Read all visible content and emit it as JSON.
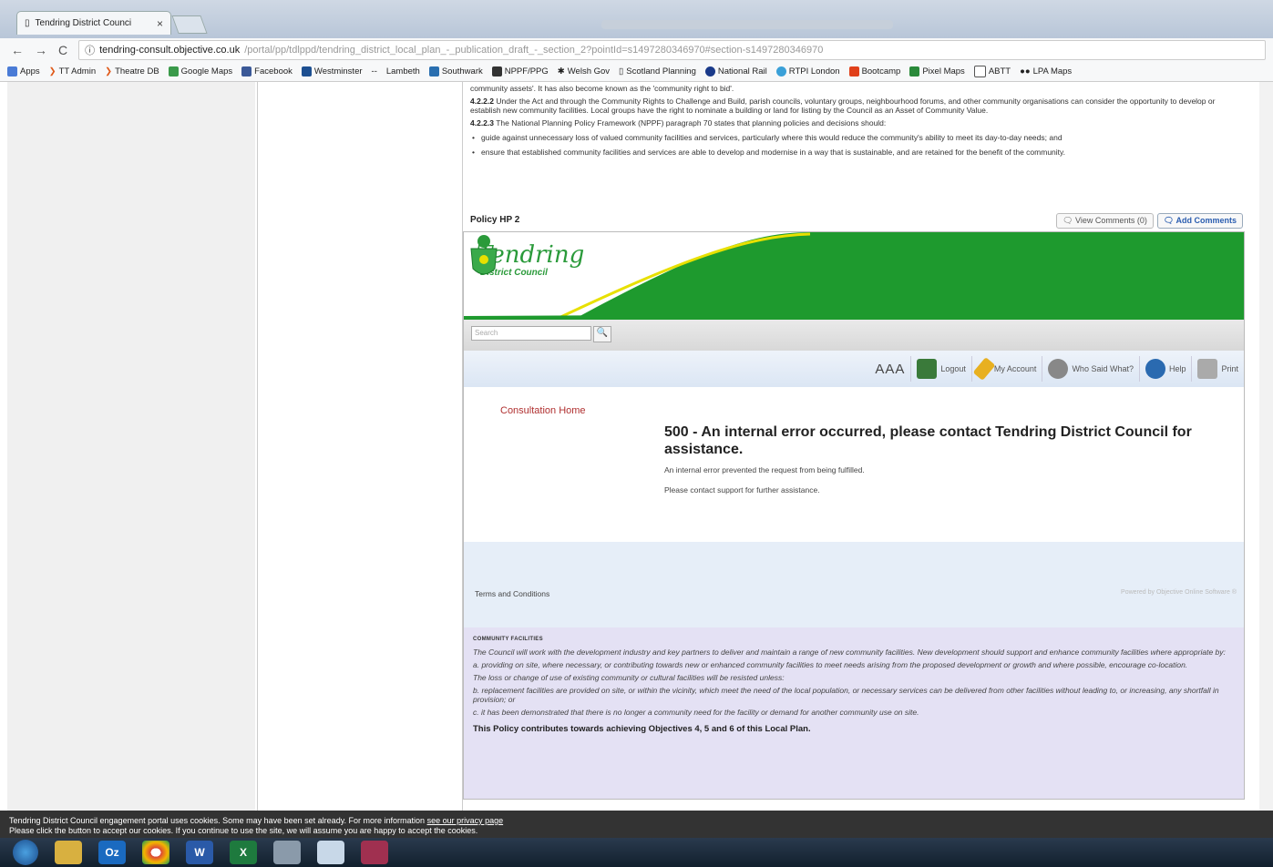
{
  "browser": {
    "tab_title": "Tendring District Counci",
    "tab_close": "×",
    "url_host": "tendring-consult.objective.co.uk",
    "url_path": "/portal/pp/tdlppd/tendring_district_local_plan_-_publication_draft_-_section_2?pointId=s1497280346970#section-s1497280346970",
    "bookmarks": [
      "Apps",
      "TT Admin",
      "Theatre DB",
      "Google Maps",
      "Facebook",
      "Westminster",
      "Lambeth",
      "Southwark",
      "NPPF/PPG",
      "Welsh Gov",
      "Scotland Planning",
      "National Rail",
      "RTPI London",
      "Bootcamp",
      "Pixel Maps",
      "ABTT",
      "LPA Maps"
    ],
    "bookmark_sep": "--"
  },
  "doc": {
    "line0": "community assets'. It has also become known as the 'community right to bid'.",
    "p1_num": "4.2.2.2",
    "p1": " Under the Act and through the Community Rights to Challenge and Build, parish councils, voluntary groups, neighbourhood forums, and other community organisations can consider the opportunity to develop or establish new community facilities. Local groups have the right to nominate a building or land for listing by the Council as an Asset of Community Value.",
    "p2_num": "4.2.2.3",
    "p2": " The National Planning Policy Framework (NPPF) paragraph 70 states that planning policies and decisions should:",
    "bullet1": "guide against unnecessary loss of valued community facilities and services, particularly where this would reduce the community's ability to meet its day-to-day needs; and",
    "bullet2": "ensure that established community facilities and services are able to develop and modernise in a way that is sustainable, and are retained for the benefit of the community.",
    "policy_heading": "Policy HP 2",
    "view_comments": "View Comments (0)",
    "add_comments": "Add Comments"
  },
  "frame": {
    "logo_title": "Tendring",
    "logo_sub": "District Council",
    "search_placeholder": "Search",
    "search_btn": "🔍",
    "aaa": "AAA",
    "tools": [
      "Logout",
      "My Account",
      "Who Said What?",
      "Help",
      "Print"
    ],
    "consultation_home": "Consultation Home",
    "error_title": "500 - An internal error occurred, please contact Tendring District Council for assistance.",
    "error_msg": "An internal error prevented the request from being fulfilled.",
    "error_msg2": "Please contact support for further assistance.",
    "terms": "Terms and Conditions",
    "powered": "Powered by Objective Online Software ®"
  },
  "policy": {
    "heading": "COMMUNITY FACILITIES",
    "l1": "The Council will work with the development industry and key partners to deliver and maintain a range of new community facilities. New development should support and enhance community facilities where appropriate by:",
    "l2": "a. providing on site, where necessary, or contributing towards new or enhanced community facilities to meet needs arising from the proposed development or growth and where possible, encourage co-location.",
    "l3": "The loss or change of use of existing community or cultural facilities will be resisted unless:",
    "l4": "b. replacement facilities are provided on site, or within the vicinity, which meet the need of the local population, or necessary services can be delivered from other facilities without leading to, or increasing, any shortfall in provision; or",
    "l5": "c. it has been demonstrated that there is no longer a community need for the facility or demand for another community use on site.",
    "l6": "This Policy contributes towards achieving Objectives 4, 5 and 6 of this Local Plan."
  },
  "cookie": {
    "line1": "Tendring District Council engagement portal uses cookies. Some may have been set already. For more information ",
    "link": "see our privacy page",
    "line2": "Please click the button to accept our cookies. If you continue to use the site, we will assume you are happy to accept the cookies."
  },
  "taskbar": {
    "icons": [
      "windows-start-icon",
      "file-explorer-icon",
      "outlook-icon",
      "chrome-icon",
      "word-icon",
      "excel-icon",
      "paint-icon",
      "notepad-icon",
      "media-icon"
    ],
    "labels": [
      "",
      "",
      "Oz",
      "",
      "W",
      "X",
      "",
      "",
      ""
    ]
  },
  "colors": {
    "council_green": "#1e9a2e",
    "error_link": "#b03030",
    "policy_bg": "#e4e1f4"
  }
}
